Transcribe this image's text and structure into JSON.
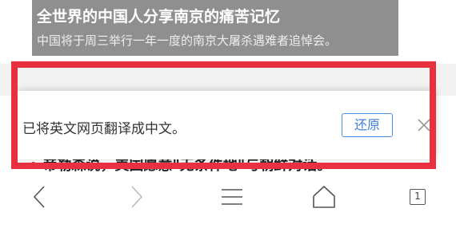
{
  "article": {
    "headline": "全世界的中国人分享南京的痛苦记忆",
    "subheadline": "中国将于周三举行一年一度的南京大屠杀遇难者追悼会。",
    "bullet_text": "帝勒森说，美国愿意\"无条件地\"与朝鲜对话。"
  },
  "translation_bar": {
    "message": "已将英文网页翻译成中文。",
    "restore_label": "还原"
  },
  "bottom_nav": {
    "tab_count": "1"
  },
  "colors": {
    "highlight": "#e8303f",
    "accent": "#4a90e2",
    "hero_bg": "#8f8f8f"
  }
}
